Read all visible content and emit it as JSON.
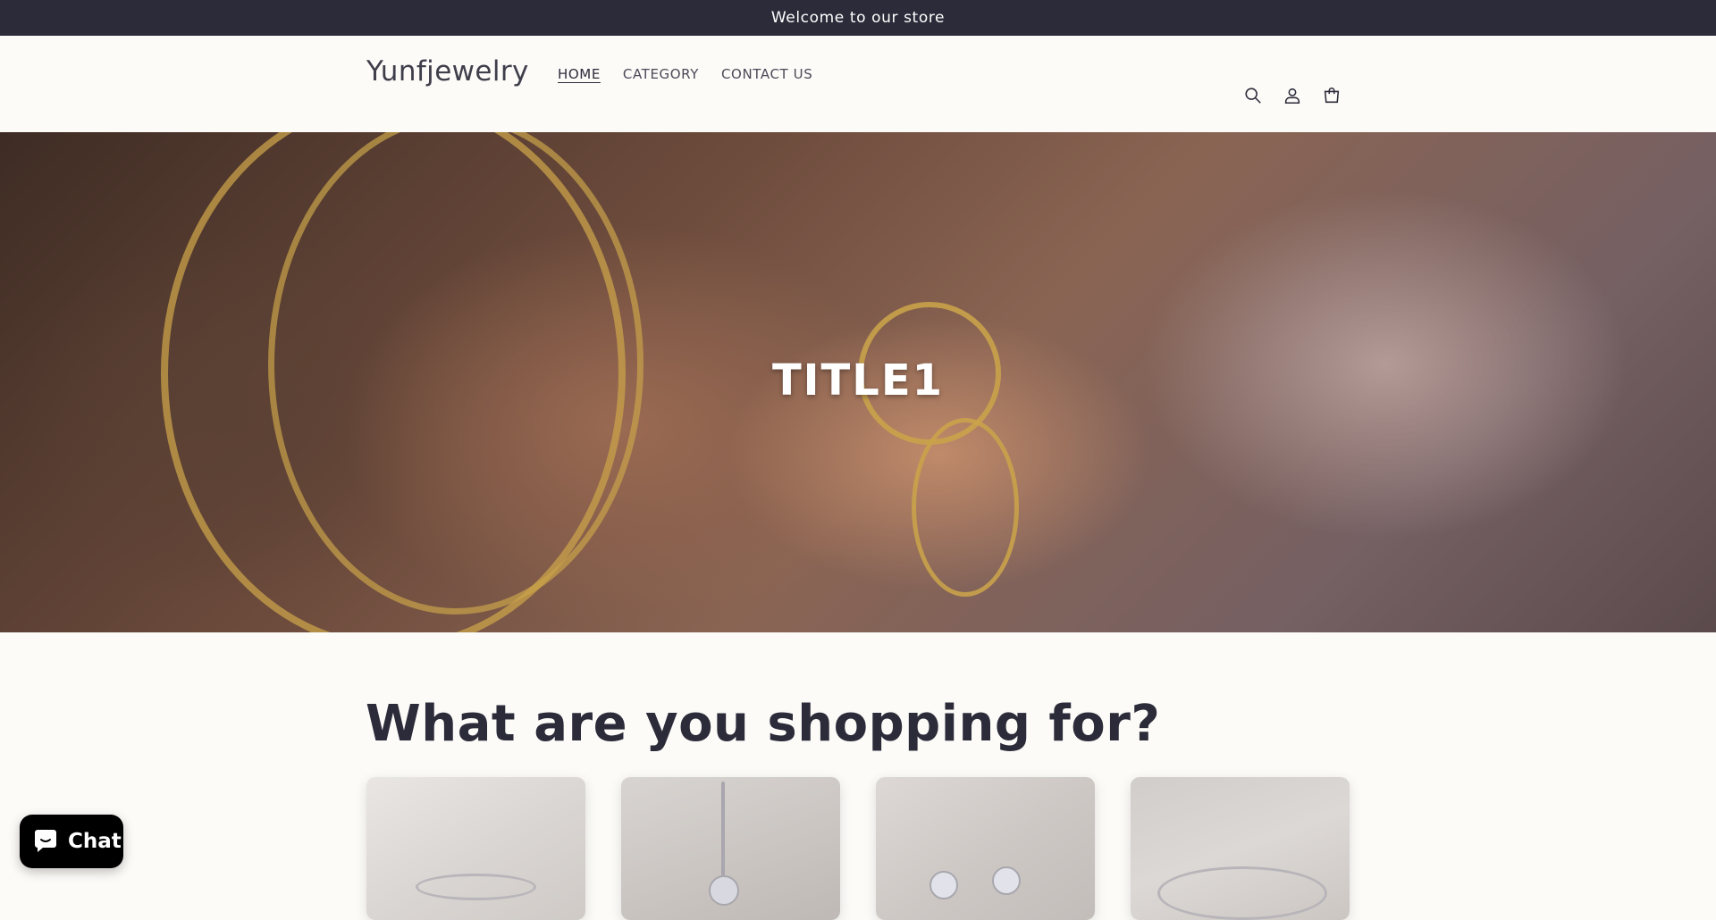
{
  "announcement": {
    "text": "Welcome to our store"
  },
  "header": {
    "logo": "Yunfjewelry",
    "nav": [
      {
        "label": "HOME",
        "active": true
      },
      {
        "label": "CATEGORY",
        "active": false
      },
      {
        "label": "CONTACT US",
        "active": false
      }
    ],
    "icons": [
      "search-icon",
      "account-icon",
      "cart-icon"
    ]
  },
  "hero": {
    "title": "TITLE1"
  },
  "section": {
    "title": "What are you shopping for?"
  },
  "cards": [
    "card-rings",
    "card-necklaces",
    "card-earrings",
    "card-bracelets"
  ],
  "chat": {
    "label": "Chat"
  },
  "colors": {
    "announcement_bg": "#2c2b39",
    "page_bg": "#fcfbf8",
    "text": "#2c2b39",
    "chat_bg": "#000000"
  }
}
